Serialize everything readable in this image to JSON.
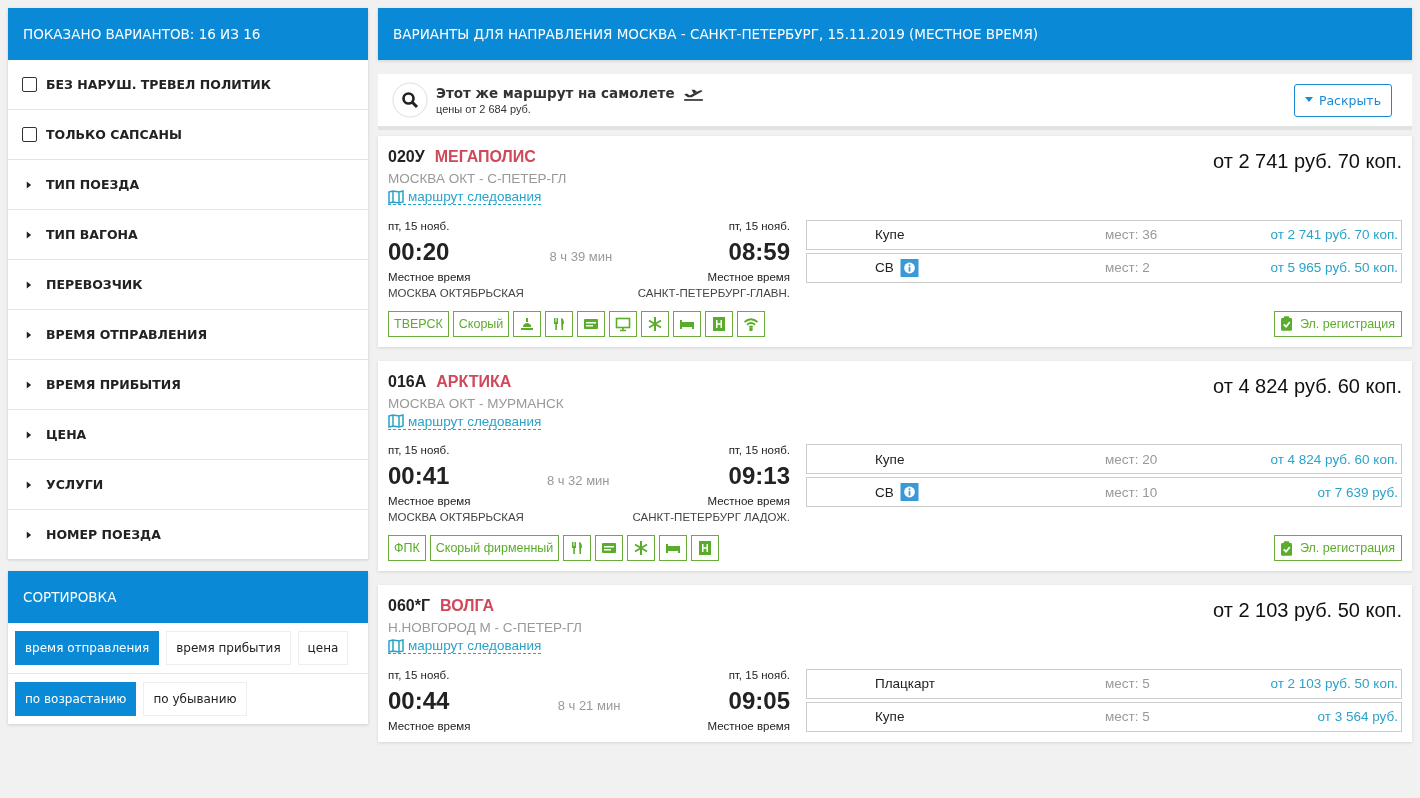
{
  "sidebar": {
    "header": "ПОКАЗАНО ВАРИАНТОВ: 16 ИЗ 16",
    "filters": [
      {
        "kind": "checkbox",
        "label": "БЕЗ НАРУШ. ТРЕВЕЛ ПОЛИТИК",
        "checked": false
      },
      {
        "kind": "checkbox",
        "label": "ТОЛЬКО САПСАНЫ",
        "checked": false
      },
      {
        "kind": "group",
        "label": "ТИП ПОЕЗДА",
        "expanded": false
      },
      {
        "kind": "group",
        "label": "ТИП ВАГОНА",
        "expanded": false
      },
      {
        "kind": "group",
        "label": "ПЕРЕВОЗЧИК",
        "expanded": false
      },
      {
        "kind": "group",
        "label": "ВРЕМЯ ОТПРАВЛЕНИЯ",
        "expanded": false
      },
      {
        "kind": "group",
        "label": "ВРЕМЯ ПРИБЫТИЯ",
        "expanded": false
      },
      {
        "kind": "group",
        "label": "ЦЕНА",
        "expanded": false
      },
      {
        "kind": "group",
        "label": "УСЛУГИ",
        "expanded": false
      },
      {
        "kind": "group",
        "label": "НОМЕР ПОЕЗДА",
        "expanded": false
      }
    ]
  },
  "sorting": {
    "title": "СОРТИРОВКА",
    "fields": [
      {
        "label": "время отправления",
        "selected": true
      },
      {
        "label": "время прибытия",
        "selected": false
      },
      {
        "label": "цена",
        "selected": false
      }
    ],
    "orders": [
      {
        "label": "по возрастанию",
        "selected": true
      },
      {
        "label": "по убыванию",
        "selected": false
      }
    ]
  },
  "results": {
    "header": "ВАРИАНТЫ ДЛЯ НАПРАВЛЕНИЯ МОСКВА - САНКТ-ПЕТЕРБУРГ, 15.11.2019 (МЕСТНОЕ ВРЕМЯ)",
    "flight_offer": {
      "title": "Этот же маршрут на самолете",
      "subtitle": "цены от 2 684 руб.",
      "button": "Раскрыть"
    },
    "trains": [
      {
        "number": "020У",
        "name": "МЕГАПОЛИС",
        "route": "МОСКВА ОКТ - С-ПЕТЕР-ГЛ",
        "route_link": "маршрут следования",
        "price": "от 2 741 руб. 70 коп.",
        "departure": {
          "date": "пт, 15 нояб.",
          "time": "00:20",
          "note": "Местное время",
          "station": "МОСКВА ОКТЯБРЬСКАЯ"
        },
        "duration": "8 ч 39 мин",
        "arrival": {
          "date": "пт, 15 нояб.",
          "time": "08:59",
          "note": "Местное время",
          "station": "САНКТ-ПЕТЕРБУРГ-ГЛАВН."
        },
        "tariffs": [
          {
            "class": "Купе",
            "info": false,
            "seats": "мест: 36",
            "price": "от 2 741 руб. 70 коп."
          },
          {
            "class": "СВ",
            "info": true,
            "seats": "мест: 2",
            "price": "от 5 965 руб. 50 коп."
          }
        ],
        "features": [
          {
            "kind": "text",
            "label": "ТВЕРСК"
          },
          {
            "kind": "text",
            "label": "Скорый"
          },
          {
            "kind": "service"
          },
          {
            "kind": "meal"
          },
          {
            "kind": "ticket"
          },
          {
            "kind": "tv"
          },
          {
            "kind": "climate"
          },
          {
            "kind": "bed"
          },
          {
            "kind": "wc"
          },
          {
            "kind": "wifi"
          }
        ],
        "registration": "Эл. регистрация"
      },
      {
        "number": "016А",
        "name": "АРКТИКА",
        "route": "МОСКВА ОКТ - МУРМАНСК",
        "route_link": "маршрут следования",
        "price": "от 4 824 руб. 60 коп.",
        "departure": {
          "date": "пт, 15 нояб.",
          "time": "00:41",
          "note": "Местное время",
          "station": "МОСКВА ОКТЯБРЬСКАЯ"
        },
        "duration": "8 ч 32 мин",
        "arrival": {
          "date": "пт, 15 нояб.",
          "time": "09:13",
          "note": "Местное время",
          "station": "САНКТ-ПЕТЕРБУРГ ЛАДОЖ."
        },
        "tariffs": [
          {
            "class": "Купе",
            "info": false,
            "seats": "мест: 20",
            "price": "от 4 824 руб. 60 коп."
          },
          {
            "class": "СВ",
            "info": true,
            "seats": "мест: 10",
            "price": "от 7 639 руб."
          }
        ],
        "features": [
          {
            "kind": "text",
            "label": "ФПК"
          },
          {
            "kind": "text",
            "label": "Скорый фирменный"
          },
          {
            "kind": "meal"
          },
          {
            "kind": "ticket"
          },
          {
            "kind": "climate"
          },
          {
            "kind": "bed"
          },
          {
            "kind": "wc"
          }
        ],
        "registration": "Эл. регистрация"
      },
      {
        "number": "060*Г",
        "name": "ВОЛГА",
        "route": "Н.НОВГОРОД М - С-ПЕТЕР-ГЛ",
        "route_link": "маршрут следования",
        "price": "от 2 103 руб. 50 коп.",
        "departure": {
          "date": "пт, 15 нояб.",
          "time": "00:44",
          "note": "Местное время"
        },
        "duration": "8 ч 21 мин",
        "arrival": {
          "date": "пт, 15 нояб.",
          "time": "09:05",
          "note": "Местное время"
        },
        "tariffs": [
          {
            "class": "Плацкарт",
            "info": false,
            "seats": "мест: 5",
            "price": "от 2 103 руб. 50 коп."
          },
          {
            "class": "Купе",
            "info": false,
            "seats": "мест: 5",
            "price": "от 3 564 руб."
          }
        ]
      }
    ]
  }
}
